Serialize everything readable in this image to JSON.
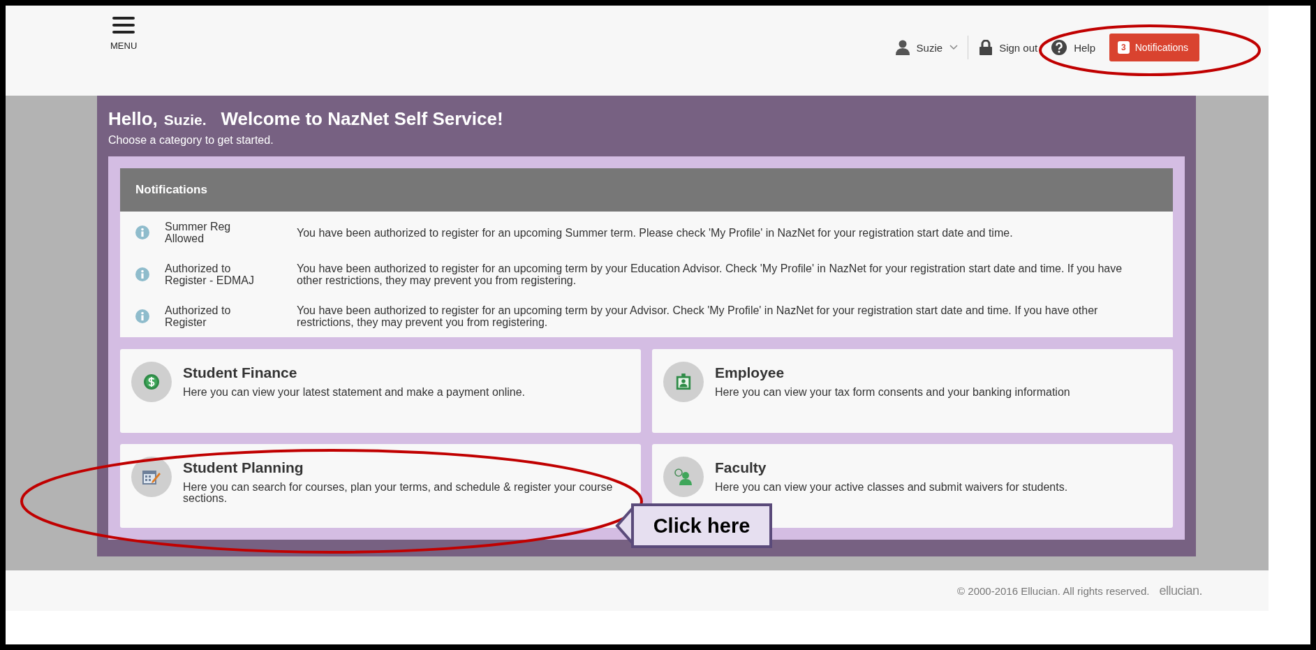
{
  "header": {
    "menu_label": "MENU",
    "user": "Suzie",
    "sign_out": "Sign out",
    "help": "Help",
    "notification_count": "3",
    "notifications_label": "Notifications"
  },
  "welcome": {
    "hello": "Hello,",
    "name": "Suzie.",
    "title": "Welcome to NazNet Self Service!",
    "subtitle": "Choose a category to get started."
  },
  "notifications": {
    "title": "Notifications",
    "items": [
      {
        "title": "Summer Reg Allowed",
        "message": "You have been authorized to register for an upcoming Summer term. Please check 'My Profile' in NazNet for your registration start date and time."
      },
      {
        "title": "Authorized to Register - EDMAJ",
        "message": "You have been authorized to register for an upcoming term by your Education Advisor. Check 'My Profile' in NazNet for your registration start date and time. If you have other restrictions, they may prevent you from registering."
      },
      {
        "title": "Authorized to Register",
        "message": "You have been authorized to register for an upcoming term by your Advisor. Check 'My Profile' in NazNet for your registration start date and time. If you have other restrictions, they may prevent you from registering."
      }
    ]
  },
  "categories": [
    {
      "kind": "finance",
      "title": "Student Finance",
      "description": "Here you can view your latest statement and make a payment online."
    },
    {
      "kind": "employee",
      "title": "Employee",
      "description": "Here you can view your tax form consents and your banking information"
    },
    {
      "kind": "planning",
      "title": "Student Planning",
      "description": "Here you can search for courses, plan your terms, and schedule & register your course sections."
    },
    {
      "kind": "faculty",
      "title": "Faculty",
      "description": "Here you can view your active classes and submit waivers for students."
    }
  ],
  "footer": {
    "copyright": "© 2000-2016 Ellucian. All rights reserved.",
    "logo": "ellucian."
  },
  "callout": "Click here"
}
